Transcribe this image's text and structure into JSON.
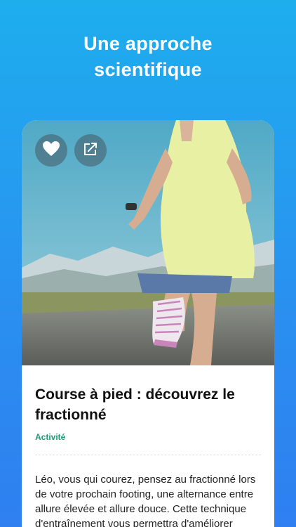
{
  "headline": {
    "line1": "Une approche",
    "line2": "scientifique"
  },
  "article": {
    "title": "Course à pied : découvrez le fractionné",
    "category": "Activité",
    "category_color": "#1a9c74",
    "body": "Léo, vous qui courez, pensez au fractionné lors de votre prochain footing, une alternance entre allure élevée et allure douce. Cette technique d'entraînement vous permettra d'améliorer"
  },
  "actions": {
    "like_icon": "heart-icon",
    "share_icon": "share-icon"
  },
  "colors": {
    "background_top": "#1eaeee",
    "background_bottom": "#2f7ff0"
  }
}
